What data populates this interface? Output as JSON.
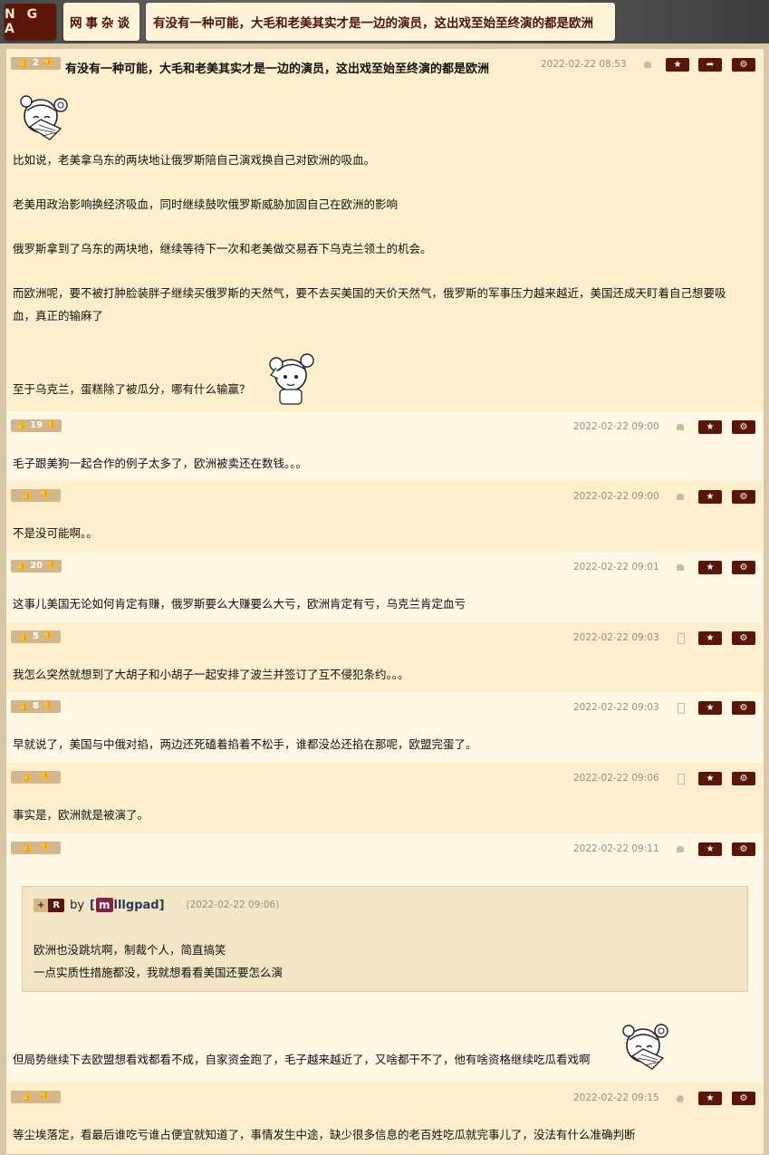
{
  "header": {
    "logo": "N G A",
    "forum": "网事杂谈",
    "thread_title": "有没有一种可能，大毛和老美其实才是一边的演员，这出戏至始至终演的都是欧洲"
  },
  "main_post": {
    "votes": "2",
    "title": "有没有一种可能，大毛和老美其实才是一边的演员，这出戏至始至终演的都是欧洲",
    "timestamp": "2022-02-22 08:53",
    "paragraphs": [
      "比如说，老美拿乌东的两块地让俄罗斯陪自己演戏换自己对欧洲的吸血。",
      "老美用政治影响换经济吸血，同时继续鼓吹俄罗斯威胁加固自己在欧洲的影响",
      "俄罗斯拿到了乌东的两块地，继续等待下一次和老美做交易吞下乌克兰领土的机会。",
      "而欧洲呢，要不被打肿脸装胖子继续买俄罗斯的天然气，要不去买美国的天价天然气，俄罗斯的军事压力越来越近，美国还成天盯着自己想要吸",
      "血，真正的输麻了",
      "至于乌克兰，蛋糕除了被瓜分，哪有什么输赢？"
    ]
  },
  "replies": [
    {
      "votes": "19",
      "timestamp": "2022-02-22 09:00",
      "device": "android",
      "text": "毛子跟美狗一起合作的例子太多了，欧洲被卖还在数钱。。。"
    },
    {
      "votes": "",
      "timestamp": "2022-02-22 09:00",
      "device": "android",
      "text": "不是没可能啊。。"
    },
    {
      "votes": "20",
      "timestamp": "2022-02-22 09:01",
      "device": "android",
      "text": "这事儿美国无论如何肯定有赚，俄罗斯要么大赚要么大亏，欧洲肯定有亏，乌克兰肯定血亏"
    },
    {
      "votes": "5",
      "timestamp": "2022-02-22 09:03",
      "device": "phone",
      "text": "我怎么突然就想到了大胡子和小胡子一起安排了波兰并签订了互不侵犯条约。。。"
    },
    {
      "votes": "8",
      "timestamp": "2022-02-22 09:03",
      "device": "phone",
      "text": "早就说了，美国与中俄对掐，两边还死磕着掐着不松手，谁都没怂还掐在那呢，欧盟完蛋了。"
    },
    {
      "votes": "",
      "timestamp": "2022-02-22 09:06",
      "device": "phone",
      "text": "事实是，欧洲就是被演了。"
    },
    {
      "votes": "",
      "timestamp": "2022-02-22 09:11",
      "device": "android",
      "quote": {
        "tag_plus": "+",
        "tag_r": "R",
        "by": "by",
        "user_prefix": "[",
        "user_badge": "m",
        "user_rest": "lllgpad]",
        "time": "(2022-02-22 09:06)",
        "lines": [
          "欧洲也没跳坑啊，制裁个人，简直搞笑",
          "一点实质性措施都没，我就想看看美国还要怎么演"
        ]
      },
      "text": "但局势继续下去欧盟想看戏都看不成，自家资金跑了，毛子越来越近了，又啥都干不了，他有啥资格继续吃瓜看戏啊"
    },
    {
      "votes": "",
      "timestamp": "2022-02-22 09:15",
      "device": "apple",
      "text": "等尘埃落定，看最后谁吃亏谁占便宜就知道了，事情发生中途，缺少很多信息的老百姓吃瓜就完事儿了，没法有什么准确判断"
    }
  ],
  "icons": {
    "thumb_up": "thumb-up-icon",
    "thumb_down": "thumb-down-icon",
    "star": "star-icon",
    "share": "share-icon",
    "settings": "gear-icon"
  },
  "colors": {
    "accent": "#5a1507",
    "vote_bg": "#d4b68d",
    "post_odd": "#fdefcb",
    "post_even": "#fff7e4",
    "timestamp": "#9b8e7a"
  }
}
